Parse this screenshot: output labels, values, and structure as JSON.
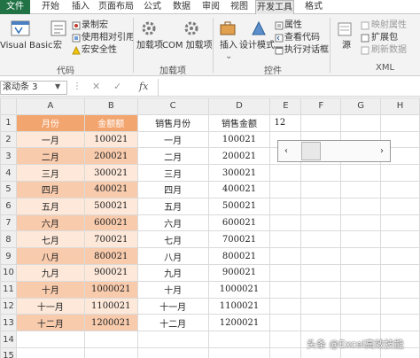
{
  "tabs": [
    "文件",
    "开始",
    "插入",
    "页面布局",
    "公式",
    "数据",
    "审阅",
    "视图",
    "开发工具",
    "格式"
  ],
  "ribbon": {
    "visual_basic": "Visual Basic",
    "macro": "宏",
    "record_macro": "录制宏",
    "relative_ref": "使用相对引用",
    "macro_security": "宏安全性",
    "group_code": "代码",
    "addins": "加载项",
    "com_addins": "COM 加载项",
    "group_addins": "加载项",
    "insert": "插入",
    "design_mode": "设计模式",
    "properties": "属性",
    "view_code": "查看代码",
    "run_dialog": "执行对话框",
    "group_controls": "控件",
    "source": "源",
    "map_properties": "映射属性",
    "expansion_pack": "扩展包",
    "refresh_data": "刷新数据",
    "group_xml": "XML"
  },
  "formula_bar": {
    "name_box": "滚动条 3",
    "fx": "fx",
    "value": ""
  },
  "columns": [
    "A",
    "B",
    "C",
    "D",
    "E",
    "F",
    "G",
    "H"
  ],
  "rows": [
    "1",
    "2",
    "3",
    "4",
    "5",
    "6",
    "7",
    "8",
    "9",
    "10",
    "11",
    "12",
    "13",
    "14",
    "15"
  ],
  "header_row": {
    "a": "月份",
    "b": "金额额",
    "c": "销售月份",
    "d": "销售金额",
    "e": "12"
  },
  "data_rows": [
    {
      "a": "一月",
      "b": "100021",
      "c": "一月",
      "d": "100021"
    },
    {
      "a": "二月",
      "b": "200021",
      "c": "二月",
      "d": "200021"
    },
    {
      "a": "三月",
      "b": "300021",
      "c": "三月",
      "d": "300021"
    },
    {
      "a": "四月",
      "b": "400021",
      "c": "四月",
      "d": "400021"
    },
    {
      "a": "五月",
      "b": "500021",
      "c": "五月",
      "d": "500021"
    },
    {
      "a": "六月",
      "b": "600021",
      "c": "六月",
      "d": "600021"
    },
    {
      "a": "七月",
      "b": "700021",
      "c": "七月",
      "d": "700021"
    },
    {
      "a": "八月",
      "b": "800021",
      "c": "八月",
      "d": "800021"
    },
    {
      "a": "九月",
      "b": "900021",
      "c": "九月",
      "d": "900021"
    },
    {
      "a": "十月",
      "b": "1000021",
      "c": "十月",
      "d": "1000021"
    },
    {
      "a": "十一月",
      "b": "1100021",
      "c": "十一月",
      "d": "1100021"
    },
    {
      "a": "十二月",
      "b": "1200021",
      "c": "十二月",
      "d": "1200021"
    }
  ],
  "scrollbar_control": {
    "left_arrow": "‹",
    "right_arrow": "›"
  },
  "watermark": "头条 @Excel高效技能",
  "colors": {
    "file_tab": "#217346",
    "header_orange": "#f3a56f",
    "band_light": "#fde8d9",
    "band_dark": "#f8cbad"
  }
}
